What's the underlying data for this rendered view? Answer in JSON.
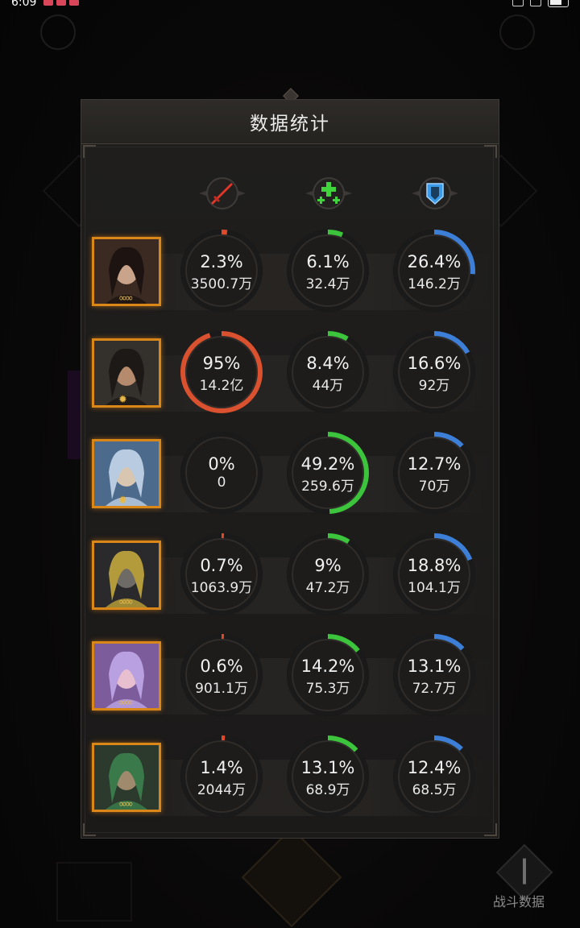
{
  "status_bar": {
    "time": "6:09"
  },
  "panel": {
    "title": "数据统计"
  },
  "columns": [
    {
      "key": "attack",
      "icon": "sword-icon",
      "color": "#e03a2a"
    },
    {
      "key": "heal",
      "icon": "plus-cross-icon",
      "color": "#36c93a"
    },
    {
      "key": "defense",
      "icon": "shield-icon",
      "color": "#3e8fe0"
    }
  ],
  "arc_colors": {
    "attack": "#e04a2a",
    "attack_big": "#d9512e",
    "heal": "#3cc43c",
    "defense": "#3d7fd6"
  },
  "heroes": [
    {
      "name": "hero-1",
      "rank": "∞∞",
      "stats": [
        {
          "percent": "2.3%",
          "amount": "3500.7万",
          "fraction": 0.023
        },
        {
          "percent": "6.1%",
          "amount": "32.4万",
          "fraction": 0.061
        },
        {
          "percent": "26.4%",
          "amount": "146.2万",
          "fraction": 0.264
        }
      ]
    },
    {
      "name": "hero-2",
      "rank": "✹",
      "stats": [
        {
          "percent": "95%",
          "amount": "14.2亿",
          "fraction": 0.95
        },
        {
          "percent": "8.4%",
          "amount": "44万",
          "fraction": 0.084
        },
        {
          "percent": "16.6%",
          "amount": "92万",
          "fraction": 0.166
        }
      ]
    },
    {
      "name": "hero-3",
      "rank": "✹",
      "stats": [
        {
          "percent": "0%",
          "amount": "0",
          "fraction": 0
        },
        {
          "percent": "49.2%",
          "amount": "259.6万",
          "fraction": 0.492
        },
        {
          "percent": "12.7%",
          "amount": "70万",
          "fraction": 0.127
        }
      ]
    },
    {
      "name": "hero-4",
      "rank": "∞∞",
      "stats": [
        {
          "percent": "0.7%",
          "amount": "1063.9万",
          "fraction": 0.007
        },
        {
          "percent": "9%",
          "amount": "47.2万",
          "fraction": 0.09
        },
        {
          "percent": "18.8%",
          "amount": "104.1万",
          "fraction": 0.188
        }
      ]
    },
    {
      "name": "hero-5",
      "rank": "∞∞",
      "stats": [
        {
          "percent": "0.6%",
          "amount": "901.1万",
          "fraction": 0.006
        },
        {
          "percent": "14.2%",
          "amount": "75.3万",
          "fraction": 0.142
        },
        {
          "percent": "13.1%",
          "amount": "72.7万",
          "fraction": 0.131
        }
      ]
    },
    {
      "name": "hero-6",
      "rank": "∞∞",
      "stats": [
        {
          "percent": "1.4%",
          "amount": "2044万",
          "fraction": 0.014
        },
        {
          "percent": "13.1%",
          "amount": "68.9万",
          "fraction": 0.131
        },
        {
          "percent": "12.4%",
          "amount": "68.5万",
          "fraction": 0.124
        }
      ]
    }
  ],
  "bottom": {
    "battle_data_label": "战斗数据"
  }
}
